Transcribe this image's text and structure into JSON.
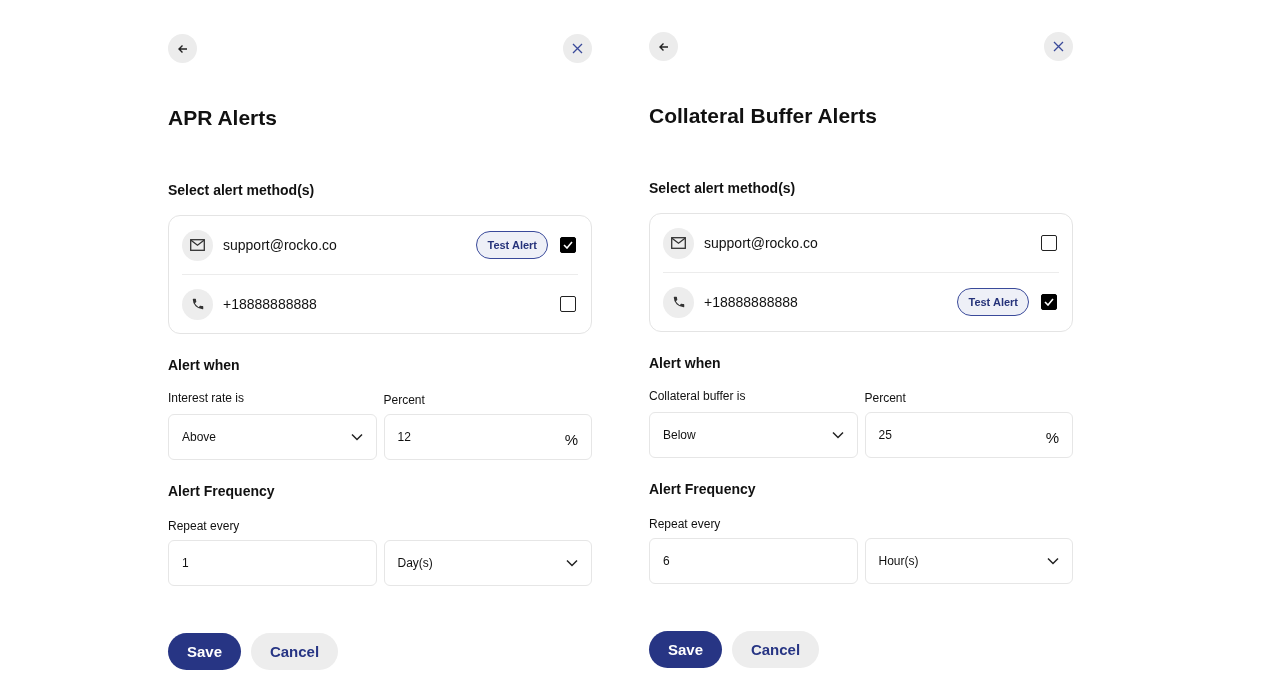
{
  "panels": [
    {
      "title": "APR Alerts",
      "methods_heading": "Select alert method(s)",
      "methods": [
        {
          "kind": "email",
          "label": "support@rocko.co",
          "checked": true,
          "test_button": "Test Alert"
        },
        {
          "kind": "phone",
          "label": "+18888888888",
          "checked": false
        }
      ],
      "alert_when": {
        "heading": "Alert when",
        "condition_label": "Interest rate is",
        "condition_value": "Above",
        "percent_label": "Percent",
        "percent_value": "12",
        "percent_suffix": "%"
      },
      "frequency": {
        "heading": "Alert Frequency",
        "repeat_label": "Repeat every",
        "repeat_value": "1",
        "unit_value": "Day(s)"
      },
      "save": "Save",
      "cancel": "Cancel"
    },
    {
      "title": "Collateral Buffer Alerts",
      "methods_heading": "Select alert method(s)",
      "methods": [
        {
          "kind": "email",
          "label": "support@rocko.co",
          "checked": false
        },
        {
          "kind": "phone",
          "label": "+18888888888",
          "checked": true,
          "test_button": "Test Alert"
        }
      ],
      "alert_when": {
        "heading": "Alert when",
        "condition_label": "Collateral buffer is",
        "condition_value": "Below",
        "percent_label": "Percent",
        "percent_value": "25",
        "percent_suffix": "%"
      },
      "frequency": {
        "heading": "Alert Frequency",
        "repeat_label": "Repeat every",
        "repeat_value": "6",
        "unit_value": "Hour(s)"
      },
      "save": "Save",
      "cancel": "Cancel"
    }
  ]
}
